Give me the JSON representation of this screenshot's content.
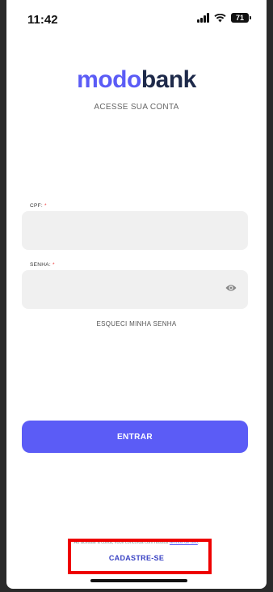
{
  "status_bar": {
    "time": "11:42",
    "battery": "71"
  },
  "logo": {
    "part1": "modo",
    "part2": "bank"
  },
  "subtitle": "ACESSE SUA CONTA",
  "cpf": {
    "label": "CPF:",
    "required": "*",
    "value": ""
  },
  "password": {
    "label": "SENHA:",
    "required": "*",
    "value": ""
  },
  "forgot_password": "ESQUECI MINHA SENHA",
  "submit_label": "ENTRAR",
  "terms": {
    "prefix": "Ao acessar a conta, você concorda com nossos ",
    "link": "termos de uso",
    "suffix": "."
  },
  "signup_label": "CADASTRE-SE",
  "colors": {
    "accent": "#5b5cf6",
    "brand_dark": "#1e2a4a",
    "highlight_border": "#e00000"
  }
}
